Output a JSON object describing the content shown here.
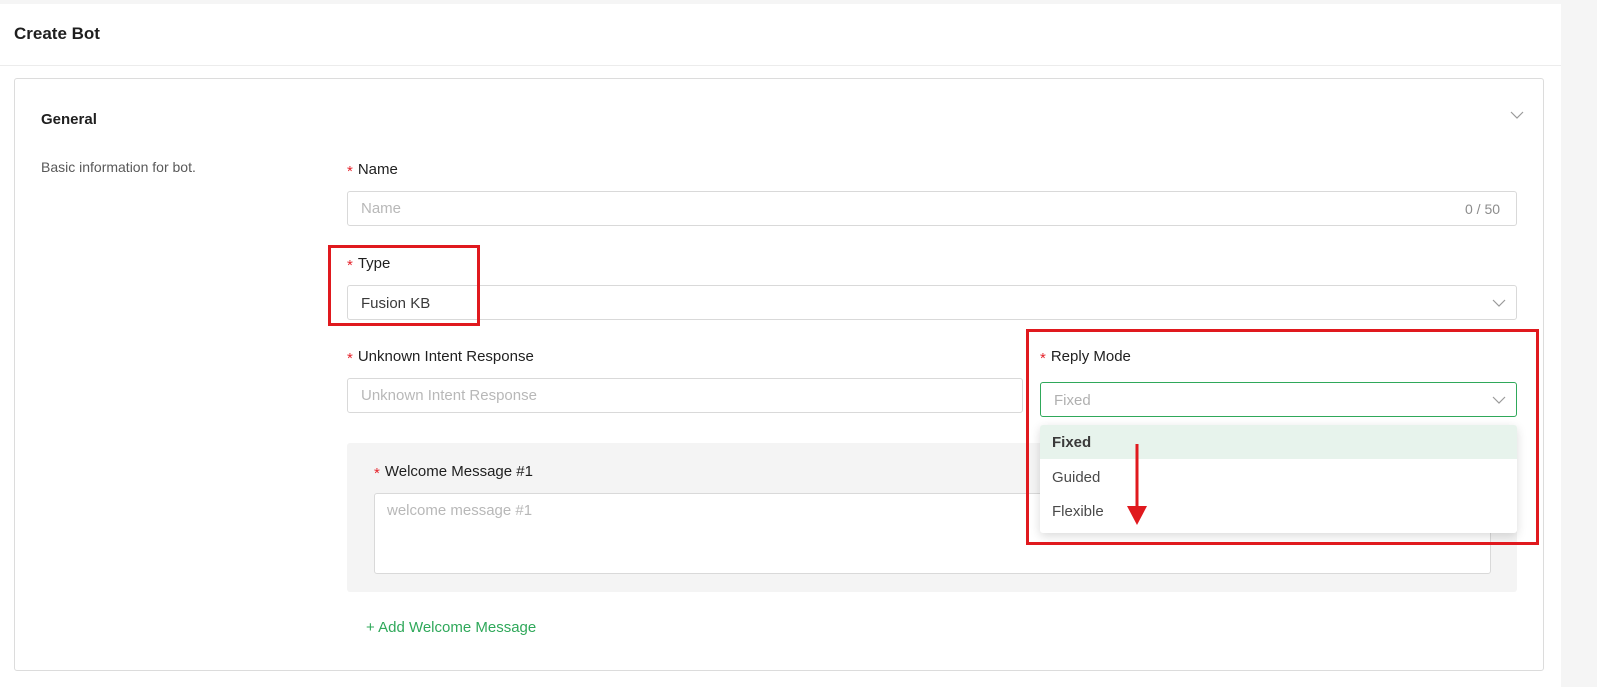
{
  "page": {
    "title": "Create Bot"
  },
  "section": {
    "title": "General",
    "description": "Basic information for bot."
  },
  "fields": {
    "name": {
      "required_mark": "*",
      "label": "Name",
      "placeholder": "Name",
      "value": "",
      "counter": "0 / 50"
    },
    "type": {
      "required_mark": "*",
      "label": "Type",
      "value": "Fusion KB"
    },
    "unknown_intent": {
      "required_mark": "*",
      "label": "Unknown Intent Response",
      "placeholder": "Unknown Intent Response",
      "value": ""
    },
    "reply_mode": {
      "required_mark": "*",
      "label": "Reply Mode",
      "placeholder": "Fixed",
      "options": [
        "Fixed",
        "Guided",
        "Flexible"
      ],
      "highlighted_option": "Fixed"
    },
    "welcome_message": {
      "required_mark": "*",
      "label": "Welcome Message #1",
      "placeholder": "welcome message #1",
      "value": ""
    }
  },
  "actions": {
    "add_welcome": "+ Add Welcome Message"
  },
  "icons": {
    "collapse": "chevron-down-icon",
    "select_arrow": "chevron-down-icon",
    "annotation_arrow": "arrow-down-icon"
  },
  "colors": {
    "accent_green": "#2fa85a",
    "required_red": "#e5232b",
    "annotation_red": "#e0191e",
    "highlight_bg": "#e7f3ec"
  }
}
